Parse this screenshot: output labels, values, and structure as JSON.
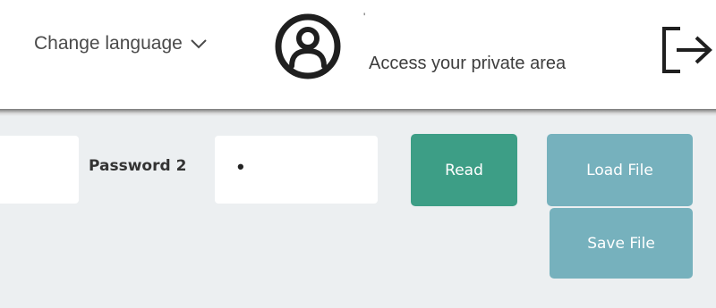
{
  "header": {
    "language_label": "Change language",
    "user_name": "'",
    "private_area_label": "Access your private area"
  },
  "form": {
    "password2_label": "Password 2",
    "password2_value": "•"
  },
  "buttons": {
    "read_label": "Read",
    "load_file_label": "Load File",
    "save_file_label": "Save File"
  },
  "colors": {
    "read_button": "#3d9e86",
    "file_buttons": "#76b1bd",
    "content_background": "#eceff1"
  },
  "icons": {
    "language": "chevron-down-icon",
    "user": "user-circle-icon",
    "logout": "logout-icon"
  }
}
